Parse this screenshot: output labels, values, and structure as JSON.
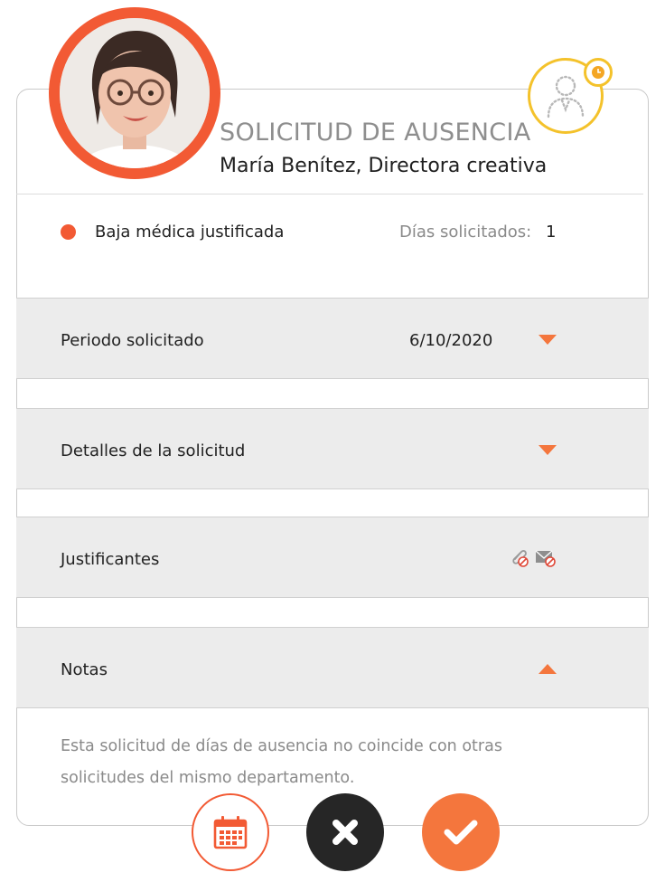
{
  "header": {
    "title": "SOLICITUD DE AUSENCIA",
    "employee": "María Benítez, Directora creativa"
  },
  "request": {
    "type": "Baja médica justificada",
    "type_color": "#f25a34",
    "days_label": "Días solicitados:",
    "days_value": "1"
  },
  "sections": {
    "period": {
      "label": "Periodo solicitado",
      "value": "6/10/2020",
      "icon": "chevron-down-icon"
    },
    "details": {
      "label": "Detalles de la solicitud",
      "icon": "chevron-down-icon"
    },
    "attachments": {
      "label": "Justificantes",
      "icons": [
        "paperclip-blocked-icon",
        "envelope-blocked-icon"
      ]
    },
    "notes": {
      "label": "Notas",
      "icon": "chevron-up-icon",
      "text_line1": "Esta solicitud de días de ausencia no coincide con otras",
      "text_line2": "solicitudes del  mismo departamento."
    }
  },
  "actions": {
    "calendar": "calendar-icon",
    "reject": "close-icon",
    "approve": "check-icon"
  },
  "colors": {
    "accent": "#f25a34",
    "pending": "#f4c22b",
    "dark": "#262626"
  }
}
